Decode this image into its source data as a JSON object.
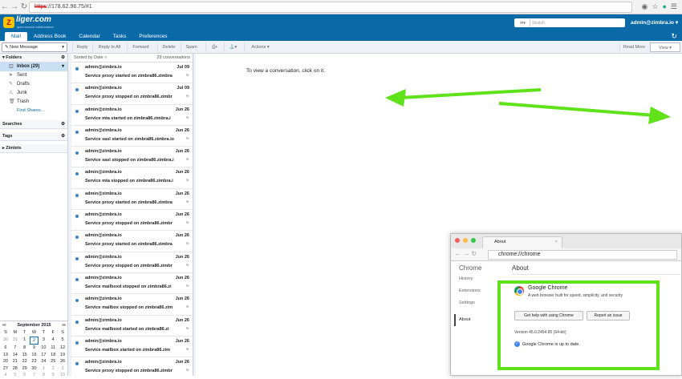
{
  "browser": {
    "url_scheme": "https",
    "url_rest": "://178.62.98.75/#1"
  },
  "header": {
    "logo_name": "liger.com",
    "logo_tagline": "open source collaboration",
    "search_placeholder": "Search",
    "user": "admin@zimbra.io"
  },
  "app_tabs": [
    "Mail",
    "Address Book",
    "Calendar",
    "Tasks",
    "Preferences"
  ],
  "toolbar": {
    "new_message": "New Message",
    "reply": "Reply",
    "reply_all": "Reply to All",
    "forward": "Forward",
    "delete": "Delete",
    "spam": "Spam",
    "actions": "Actions",
    "read_more": "Read More",
    "view": "View"
  },
  "sidebar": {
    "folders_title": "Folders",
    "folders": [
      "Inbox (29)",
      "Sent",
      "Drafts",
      "Junk",
      "Trash"
    ],
    "find_shares": "Find Shares...",
    "searches": "Searches",
    "tags": "Tags",
    "zimlets": "Zimlets"
  },
  "minical": {
    "title": "September 2015",
    "days": [
      "S",
      "M",
      "T",
      "W",
      "T",
      "F",
      "S"
    ],
    "cells": [
      [
        "30",
        "31",
        "1",
        "2",
        "3",
        "4",
        "5"
      ],
      [
        "6",
        "7",
        "8",
        "9",
        "10",
        "11",
        "12"
      ],
      [
        "13",
        "14",
        "15",
        "16",
        "17",
        "18",
        "19"
      ],
      [
        "20",
        "21",
        "22",
        "23",
        "24",
        "25",
        "26"
      ],
      [
        "27",
        "28",
        "29",
        "30",
        "1",
        "2",
        "3"
      ],
      [
        "4",
        "5",
        "6",
        "7",
        "8",
        "9",
        "10"
      ]
    ]
  },
  "list": {
    "sort_label": "Sorted by Date",
    "count": "29 conversations",
    "rows": [
      {
        "from": "admin@zimbra.io",
        "date": "Jul 09",
        "subject": "Service proxy started on zimbra86.zimbra"
      },
      {
        "from": "admin@zimbra.io",
        "date": "Jul 09",
        "subject": "Service proxy stopped on zimbra86.zimbr"
      },
      {
        "from": "admin@zimbra.io",
        "date": "Jun 26",
        "subject": "Service mta started on zimbra86.zimbra.i"
      },
      {
        "from": "admin@zimbra.io",
        "date": "Jun 26",
        "subject": "Service sasl started on zimbra86.zimbra.io"
      },
      {
        "from": "admin@zimbra.io",
        "date": "Jun 26",
        "subject": "Service sasl stopped on zimbra86.zimbra.i"
      },
      {
        "from": "admin@zimbra.io",
        "date": "Jun 26",
        "subject": "Service mta stopped on zimbra86.zimbra.i"
      },
      {
        "from": "admin@zimbra.io",
        "date": "Jun 26",
        "subject": "Service proxy started on zimbra86.zimbra"
      },
      {
        "from": "admin@zimbra.io",
        "date": "Jun 26",
        "subject": "Service proxy stopped on zimbra86.zimbr"
      },
      {
        "from": "admin@zimbra.io",
        "date": "Jun 26",
        "subject": "Service proxy started on zimbra86.zimbra"
      },
      {
        "from": "admin@zimbra.io",
        "date": "Jun 26",
        "subject": "Service proxy stopped on zimbra86.zimbr"
      },
      {
        "from": "admin@zimbra.io",
        "date": "Jun 26",
        "subject": "Service mailboxd stopped on zimbra86.zi"
      },
      {
        "from": "admin@zimbra.io",
        "date": "Jun 26",
        "subject": "Service mailbox stopped on zimbra86.zim"
      },
      {
        "from": "admin@zimbra.io",
        "date": "Jun 26",
        "subject": "Service mailboxd started on zimbra86.zi"
      },
      {
        "from": "admin@zimbra.io",
        "date": "Jun 26",
        "subject": "Service mailbox started on zimbra86.zim"
      },
      {
        "from": "admin@zimbra.io",
        "date": "Jun 26",
        "subject": "Service proxy stopped on zimbra86.zimbr"
      }
    ]
  },
  "reading": {
    "hint": "To view a conversation, click on it."
  },
  "chrome": {
    "tab_title": "About",
    "url": "chrome://chrome",
    "sidebar_title": "Chrome",
    "nav": [
      "History",
      "Extensions",
      "Settings",
      "About"
    ],
    "heading": "About",
    "product": "Google Chrome",
    "tagline": "A web browser built for speed, simplicity, and security",
    "help_button": "Get help with using Chrome",
    "report_button": "Report an issue",
    "version": "Version 45.0.2454.85 (64-bit)",
    "status": "Google Chrome is up to date."
  },
  "annotation_color": "#5fe21a"
}
